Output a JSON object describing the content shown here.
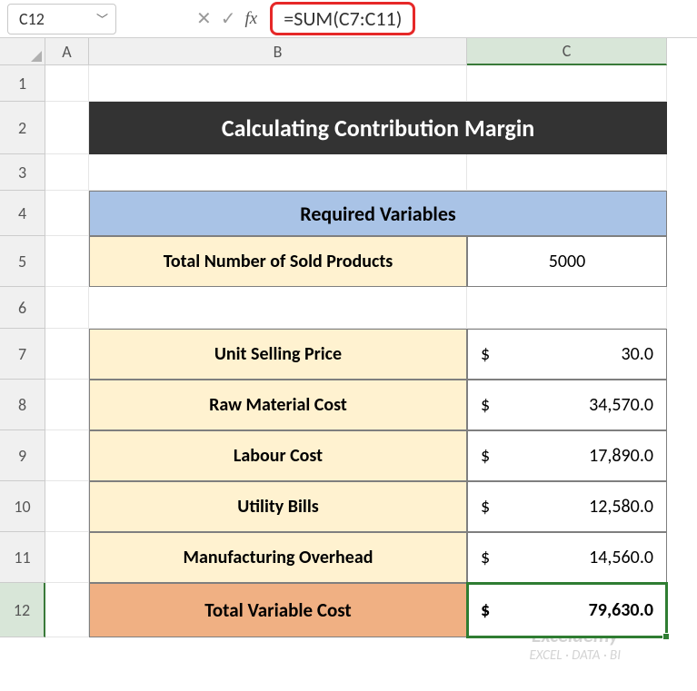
{
  "namebox": {
    "value": "C12"
  },
  "formula_bar": {
    "cancel_icon": "✕",
    "accept_icon": "✓",
    "fx_label": "fx",
    "formula": "=SUM(C7:C11)"
  },
  "columns": {
    "A": "A",
    "B": "B",
    "C": "C"
  },
  "rows": [
    "1",
    "2",
    "3",
    "4",
    "5",
    "6",
    "7",
    "8",
    "9",
    "10",
    "11",
    "12"
  ],
  "title": "Calculating Contribution Margin",
  "section_header": "Required Variables",
  "labels": {
    "sold_products": "Total Number of Sold Products",
    "unit_price": "Unit Selling Price",
    "raw_material": "Raw Material Cost",
    "labour": "Labour Cost",
    "utility": "Utility Bills",
    "overhead": "Manufacturing Overhead",
    "total_variable": "Total Variable Cost"
  },
  "values": {
    "sold_products": "5000",
    "unit_price": "30.0",
    "raw_material": "34,570.0",
    "labour": "17,890.0",
    "utility": "12,580.0",
    "overhead": "14,560.0",
    "total_variable": "79,630.0"
  },
  "currency": "$",
  "watermark": {
    "line1": "Exceldemy",
    "line2": "EXCEL · DATA · BI"
  },
  "chart_data": {
    "type": "table",
    "title": "Calculating Contribution Margin",
    "rows": [
      {
        "label": "Total Number of Sold Products",
        "value": 5000
      },
      {
        "label": "Unit Selling Price",
        "value": 30.0,
        "currency": "USD"
      },
      {
        "label": "Raw Material Cost",
        "value": 34570.0,
        "currency": "USD"
      },
      {
        "label": "Labour Cost",
        "value": 17890.0,
        "currency": "USD"
      },
      {
        "label": "Utility Bills",
        "value": 12580.0,
        "currency": "USD"
      },
      {
        "label": "Manufacturing Overhead",
        "value": 14560.0,
        "currency": "USD"
      },
      {
        "label": "Total Variable Cost",
        "value": 79630.0,
        "currency": "USD",
        "formula": "=SUM(C7:C11)"
      }
    ]
  }
}
